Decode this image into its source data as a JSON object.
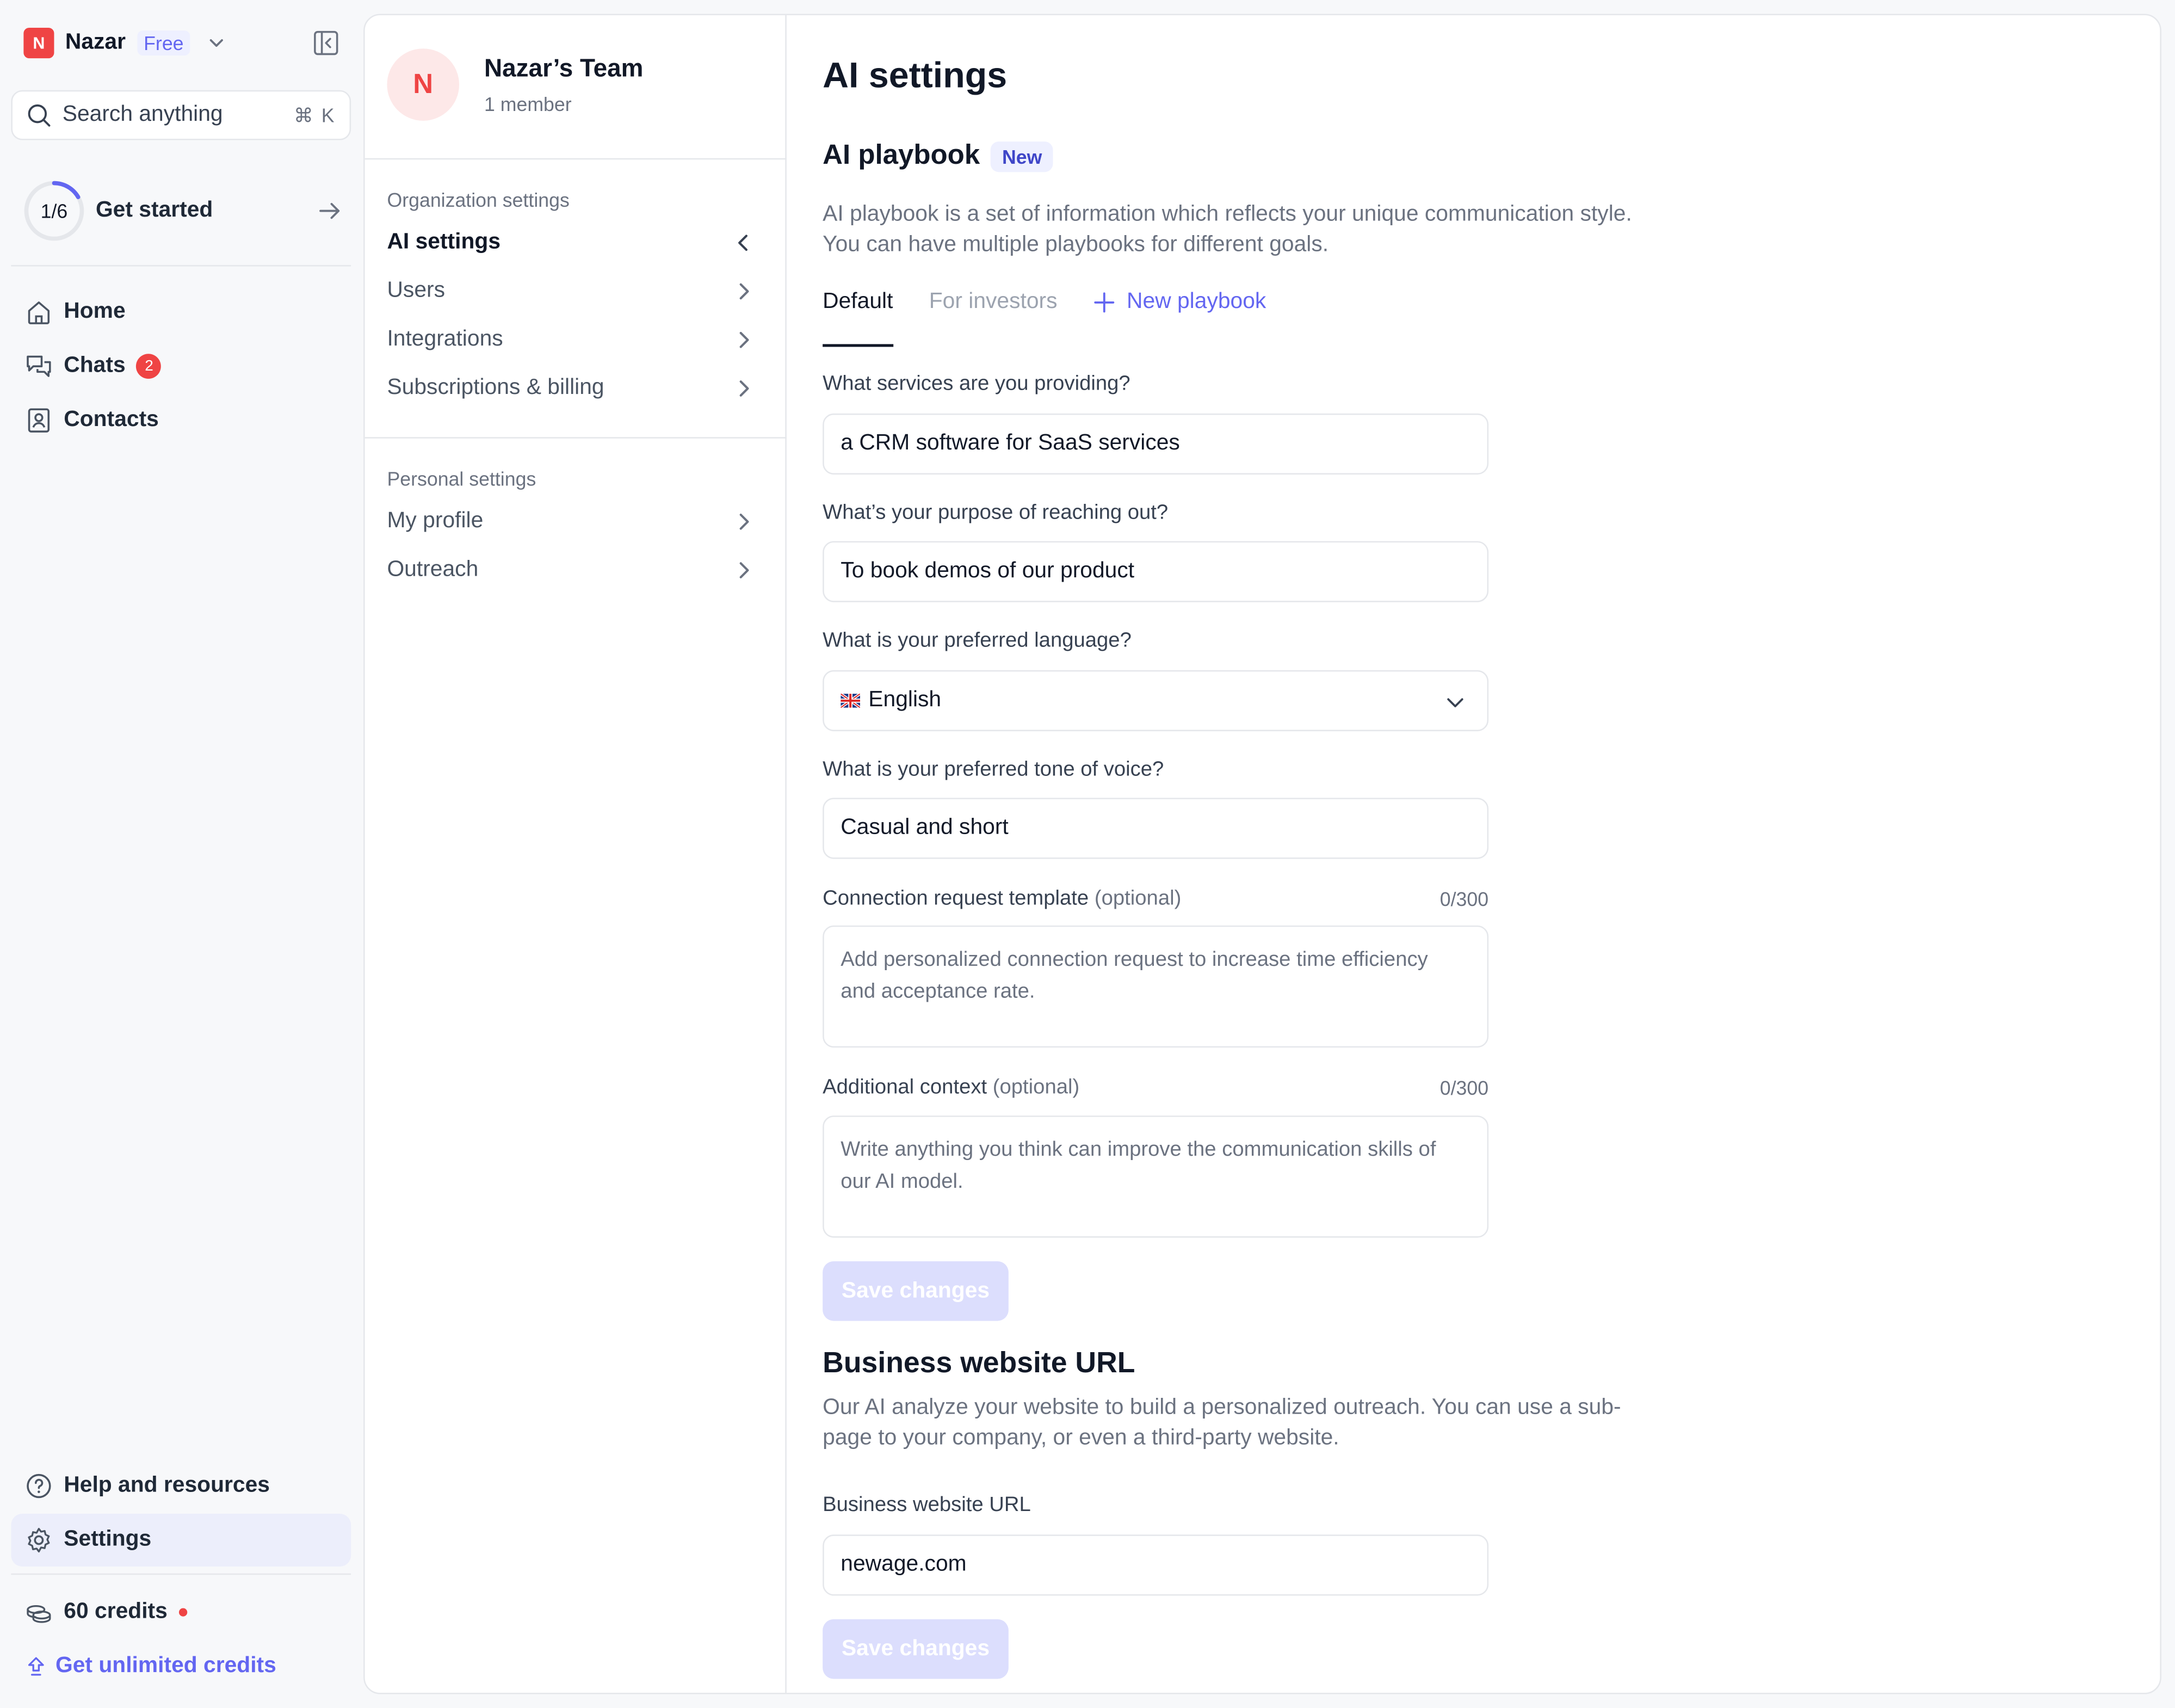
{
  "workspace": {
    "initial": "N",
    "name": "Nazar",
    "plan": "Free"
  },
  "search": {
    "placeholder": "Search anything",
    "shortcut": "⌘ K"
  },
  "onboarding": {
    "progress": "1/6",
    "progress_fraction": 0.1667,
    "label": "Get started"
  },
  "nav": {
    "items": [
      {
        "label": "Home",
        "icon": "home-icon"
      },
      {
        "label": "Chats",
        "icon": "chat-icon",
        "badge": "2"
      },
      {
        "label": "Contacts",
        "icon": "contacts-icon"
      }
    ],
    "bottom": [
      {
        "label": "Help and resources",
        "icon": "help-icon"
      },
      {
        "label": "Settings",
        "icon": "gear-icon",
        "active": true
      }
    ]
  },
  "credits": {
    "label": "60 credits",
    "upgrade": "Get unlimited credits"
  },
  "team": {
    "initial": "N",
    "name": "Nazar’s Team",
    "members": "1 member"
  },
  "settings_nav": {
    "org_title": "Organization settings",
    "org_items": [
      "AI settings",
      "Users",
      "Integrations",
      "Subscriptions & billing"
    ],
    "personal_title": "Personal settings",
    "personal_items": [
      "My profile",
      "Outreach"
    ]
  },
  "page": {
    "title": "AI settings"
  },
  "playbook": {
    "title": "AI playbook",
    "badge": "New",
    "desc_line1": "AI playbook is a set of information which reflects your unique communication style.",
    "desc_line2": "You can have multiple playbooks for different goals.",
    "tabs": [
      "Default",
      "For investors"
    ],
    "new_tab": "New playbook"
  },
  "form": {
    "services": {
      "label": "What services are you providing?",
      "value": "a CRM software for SaaS services"
    },
    "purpose": {
      "label": "What’s your purpose of reaching out?",
      "value": "To book demos of our product"
    },
    "language": {
      "label": "What is your preferred language?",
      "value": "English"
    },
    "tone": {
      "label": "What is your preferred tone of voice?",
      "value": "Casual and short"
    },
    "connection": {
      "label": "Connection request template",
      "optional": "(optional)",
      "counter": "0/300",
      "placeholder_line1": "Add personalized connection request to increase time efficiency",
      "placeholder_line2": "and acceptance rate."
    },
    "context": {
      "label": "Additional context",
      "optional": "(optional)",
      "counter": "0/300",
      "placeholder_line1": "Write anything you think can improve the communication skills of",
      "placeholder_line2": "our AI model."
    },
    "save": "Save changes"
  },
  "website": {
    "title": "Business website URL",
    "desc_line1": "Our AI analyze your website to build a personalized outreach. You can use a sub-",
    "desc_line2": "page to your company, or even a third-party website.",
    "label": "Business website URL",
    "value": "newage.com",
    "save": "Save changes"
  },
  "colors": {
    "accent": "#6366f1",
    "badge_red": "#ef4444",
    "button_disabled": "#dcdefd"
  }
}
